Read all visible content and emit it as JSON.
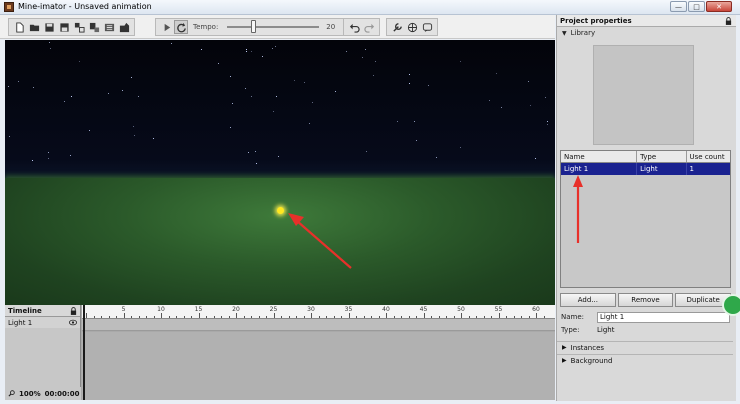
{
  "window": {
    "title": "Mine-imator - Unsaved animation",
    "minimize": "—",
    "maximize": "□",
    "close": "✕"
  },
  "toolbar": {
    "tempo_label": "Tempo:",
    "tempo_value": "20"
  },
  "timeline": {
    "header": "Timeline",
    "rows": [
      {
        "label": "Light 1"
      }
    ],
    "zoom": "100%",
    "time": "00:00:00",
    "ticks": [
      "5",
      "10",
      "15",
      "20",
      "25",
      "30",
      "35",
      "40",
      "45",
      "50",
      "55",
      "60"
    ]
  },
  "properties": {
    "header": "Project properties",
    "library_label": "Library",
    "table": {
      "columns": [
        "Name",
        "Type",
        "Use count"
      ],
      "rows": [
        {
          "name": "Light 1",
          "type": "Light",
          "use_count": "1"
        }
      ]
    },
    "buttons": {
      "add": "Add...",
      "remove": "Remove",
      "duplicate": "Duplicate"
    },
    "name_label": "Name:",
    "name_value": "Light 1",
    "type_label": "Type:",
    "type_value": "Light",
    "sections": {
      "instances": "Instances",
      "background": "Background"
    }
  },
  "colors": {
    "selection": "#1a2290",
    "annotation_arrow": "#e8302a",
    "light_point": "#ffe820"
  }
}
